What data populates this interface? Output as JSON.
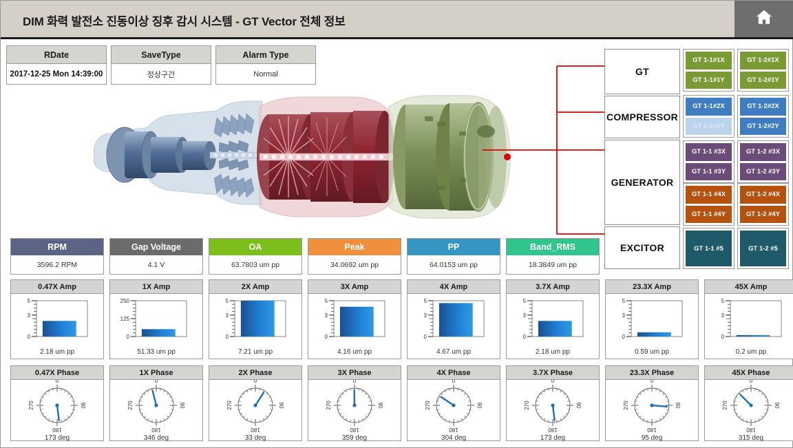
{
  "header": {
    "title": "DIM  화력 발전소 진동이상 징후 감시 시스템 - GT Vector 전체 정보",
    "home_icon": "home-icon"
  },
  "info_boxes": [
    {
      "label": "RDate",
      "value": "2017-12-25 Mon 14:39:00"
    },
    {
      "label": "SaveType",
      "value": "정상구간"
    },
    {
      "label": "Alarm Type",
      "value": "Normal"
    }
  ],
  "components": [
    {
      "name": "GT"
    },
    {
      "name": "COMPRESSOR"
    },
    {
      "name": "GENERATOR"
    },
    {
      "name": "EXCITOR"
    }
  ],
  "sensor_groups": [
    {
      "color": "#7a9a34",
      "buttons": [
        {
          "label": "GT 1-1#1X",
          "selected": false
        },
        {
          "label": "GT 1-1#1Y",
          "selected": false
        }
      ]
    },
    {
      "color": "#7a9a34",
      "buttons": [
        {
          "label": "GT 1-2#1X",
          "selected": false
        },
        {
          "label": "GT 1-2#1Y",
          "selected": false
        }
      ]
    },
    {
      "color": "#3f7cc0",
      "buttons": [
        {
          "label": "GT 1-1#2X",
          "selected": false
        },
        {
          "label": "GT 1-1#2Y",
          "selected": true
        }
      ]
    },
    {
      "color": "#3f7cc0",
      "buttons": [
        {
          "label": "GT 1-2#2X",
          "selected": false
        },
        {
          "label": "GT 1-2#2Y",
          "selected": false
        }
      ]
    },
    {
      "color": "#6b4b78",
      "buttons": [
        {
          "label": "GT 1-1 #3X",
          "selected": false
        },
        {
          "label": "GT 1-1 #3Y",
          "selected": false
        }
      ]
    },
    {
      "color": "#6b4b78",
      "buttons": [
        {
          "label": "GT 1-2 #3X",
          "selected": false
        },
        {
          "label": "GT 1-2 #3Y",
          "selected": false
        }
      ]
    },
    {
      "color": "#b5520f",
      "buttons": [
        {
          "label": "GT 1-1 #4X",
          "selected": false
        },
        {
          "label": "GT 1-1 #4Y",
          "selected": false
        }
      ]
    },
    {
      "color": "#b5520f",
      "buttons": [
        {
          "label": "GT 1-2 #4X",
          "selected": false
        },
        {
          "label": "GT 1-2 #4Y",
          "selected": false
        }
      ]
    },
    {
      "color": "#1f5a6b",
      "buttons": [
        {
          "label": "GT 1-1 #5",
          "selected": false
        }
      ]
    },
    {
      "color": "#1f5a6b",
      "buttons": [
        {
          "label": "GT 1-2 #5",
          "selected": false
        }
      ]
    }
  ],
  "metrics": [
    {
      "label": "RPM",
      "value": "3596.2 RPM",
      "color": "#5b6485"
    },
    {
      "label": "Gap Voltage",
      "value": "4.1 V",
      "color": "#6b6b6b"
    },
    {
      "label": "OA",
      "value": "63.7803 um pp",
      "color": "#7cbf1b"
    },
    {
      "label": "Peak",
      "value": "34.0692 um pp",
      "color": "#f1903c"
    },
    {
      "label": "PP",
      "value": "64.0153 um pp",
      "color": "#3596c4"
    },
    {
      "label": "Band_RMS",
      "value": "18.3849 um pp",
      "color": "#31c48d"
    }
  ],
  "chart_data": [
    {
      "type": "bar",
      "title": "0.47X Amp",
      "categories": [
        "0.47X"
      ],
      "values": [
        2.18
      ],
      "value_label": "2.18 um pp",
      "ylabel": "",
      "xlabel": "",
      "ylim": [
        0,
        5
      ],
      "yticks": [
        0,
        3,
        5
      ],
      "grid": false
    },
    {
      "type": "bar",
      "title": "1X Amp",
      "categories": [
        "1X"
      ],
      "values": [
        51.33
      ],
      "value_label": "51.33 um pp",
      "ylabel": "",
      "xlabel": "",
      "ylim": [
        0,
        250
      ],
      "yticks": [
        0,
        125,
        250
      ],
      "grid": false
    },
    {
      "type": "bar",
      "title": "2X Amp",
      "categories": [
        "2X"
      ],
      "values": [
        7.21
      ],
      "value_label": "7.21 um pp",
      "ylabel": "",
      "xlabel": "",
      "ylim": [
        0,
        5
      ],
      "yticks": [
        0,
        3,
        5
      ],
      "grid": false
    },
    {
      "type": "bar",
      "title": "3X Amp",
      "categories": [
        "3X"
      ],
      "values": [
        4.16
      ],
      "value_label": "4.16 um pp",
      "ylabel": "",
      "xlabel": "",
      "ylim": [
        0,
        5
      ],
      "yticks": [
        0,
        3,
        5
      ],
      "grid": false
    },
    {
      "type": "bar",
      "title": "4X Amp",
      "categories": [
        "4X"
      ],
      "values": [
        4.67
      ],
      "value_label": "4.67 um pp",
      "ylabel": "",
      "xlabel": "",
      "ylim": [
        0,
        5
      ],
      "yticks": [
        0,
        3,
        5
      ],
      "grid": false
    },
    {
      "type": "bar",
      "title": "3.7X Amp",
      "categories": [
        "3.7X"
      ],
      "values": [
        2.18
      ],
      "value_label": "2.18 um pp",
      "ylabel": "",
      "xlabel": "",
      "ylim": [
        0,
        5
      ],
      "yticks": [
        0,
        3,
        5
      ],
      "grid": false
    },
    {
      "type": "bar",
      "title": "23.3X Amp",
      "categories": [
        "23.3X"
      ],
      "values": [
        0.59
      ],
      "value_label": "0.59 um pp",
      "ylabel": "",
      "xlabel": "",
      "ylim": [
        0,
        5
      ],
      "yticks": [
        0,
        3,
        5
      ],
      "grid": false
    },
    {
      "type": "bar",
      "title": "45X Amp",
      "categories": [
        "45X"
      ],
      "values": [
        0.2
      ],
      "value_label": "0.2 um pp",
      "ylabel": "",
      "xlabel": "",
      "ylim": [
        0,
        5
      ],
      "yticks": [
        0,
        3,
        5
      ],
      "grid": false
    },
    {
      "type": "gauge",
      "title": "0.47X Phase",
      "value": 173,
      "value_label": "173 deg",
      "ticks": [
        0,
        90,
        180,
        270
      ],
      "range": [
        0,
        360
      ]
    },
    {
      "type": "gauge",
      "title": "1X Phase",
      "value": 346,
      "value_label": "346 deg",
      "ticks": [
        0,
        90,
        180,
        270
      ],
      "range": [
        0,
        360
      ]
    },
    {
      "type": "gauge",
      "title": "2X Phase",
      "value": 33,
      "value_label": "33 deg",
      "ticks": [
        0,
        90,
        180,
        270
      ],
      "range": [
        0,
        360
      ]
    },
    {
      "type": "gauge",
      "title": "3X Phase",
      "value": 359,
      "value_label": "359 deg",
      "ticks": [
        0,
        90,
        180,
        270
      ],
      "range": [
        0,
        360
      ]
    },
    {
      "type": "gauge",
      "title": "4X Phase",
      "value": 304,
      "value_label": "304 deg",
      "ticks": [
        0,
        90,
        180,
        270
      ],
      "range": [
        0,
        360
      ]
    },
    {
      "type": "gauge",
      "title": "3.7X Phase",
      "value": 173,
      "value_label": "173 deg",
      "ticks": [
        0,
        90,
        180,
        270
      ],
      "range": [
        0,
        360
      ]
    },
    {
      "type": "gauge",
      "title": "23.3X Phase",
      "value": 95,
      "value_label": "95 deg",
      "ticks": [
        0,
        90,
        180,
        270
      ],
      "range": [
        0,
        360
      ]
    },
    {
      "type": "gauge",
      "title": "45X Phase",
      "value": 315,
      "value_label": "315 deg",
      "ticks": [
        0,
        90,
        180,
        270
      ],
      "range": [
        0,
        360
      ]
    }
  ]
}
